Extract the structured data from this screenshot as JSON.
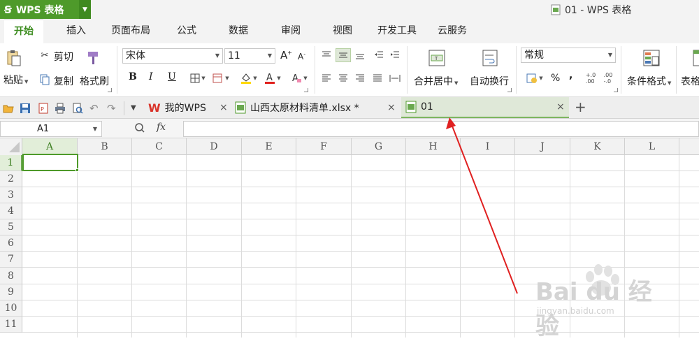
{
  "titlebar": {
    "app_name": "WPS 表格",
    "window_title": "01 - WPS 表格"
  },
  "menu_tabs": [
    "开始",
    "插入",
    "页面布局",
    "公式",
    "数据",
    "审阅",
    "视图",
    "开发工具",
    "云服务"
  ],
  "ribbon": {
    "paste": "粘贴",
    "cut": "剪切",
    "copy": "复制",
    "format_painter": "格式刷",
    "font_name": "宋体",
    "font_size": "11",
    "merge_center": "合并居中",
    "wrap_text": "自动换行",
    "number_format": "常规",
    "conditional_format": "条件格式",
    "table_style": "表格",
    "bold": "B",
    "italic": "I",
    "underline": "U",
    "percent": "%",
    "comma": ",",
    "grow_font": "A",
    "shrink_font": "A"
  },
  "doc_tabs": [
    {
      "label": "我的WPS"
    },
    {
      "label": "山西太原材料清单.xlsx *"
    },
    {
      "label": "01"
    }
  ],
  "formula_bar": {
    "name_box": "A1",
    "fx": "fx",
    "formula": ""
  },
  "grid": {
    "columns": [
      "A",
      "B",
      "C",
      "D",
      "E",
      "F",
      "G",
      "H",
      "I",
      "J",
      "K",
      "L"
    ],
    "rows": [
      "1",
      "2",
      "3",
      "4",
      "5",
      "6",
      "7",
      "8",
      "9",
      "10",
      "11"
    ],
    "selected_cell": "A1"
  },
  "watermark": {
    "logo": "Bai du 经验",
    "url": "jingyan.baidu.com"
  },
  "colors": {
    "accent": "#4e9a2a",
    "arrow": "#e02020"
  }
}
